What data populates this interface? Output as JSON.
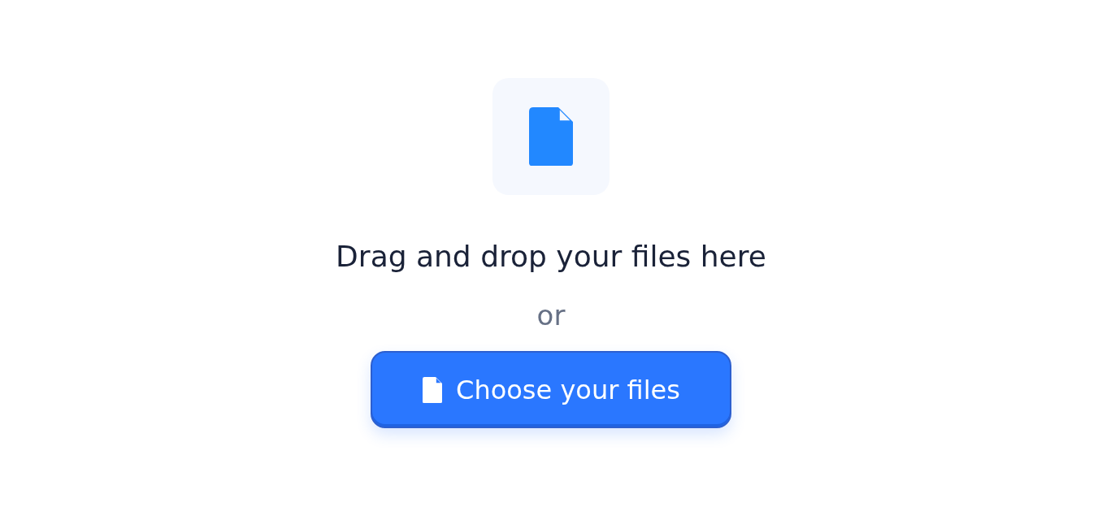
{
  "dropzone": {
    "heading": "Drag and drop your files here",
    "separator": "or",
    "button": {
      "label": "Choose your files"
    }
  }
}
